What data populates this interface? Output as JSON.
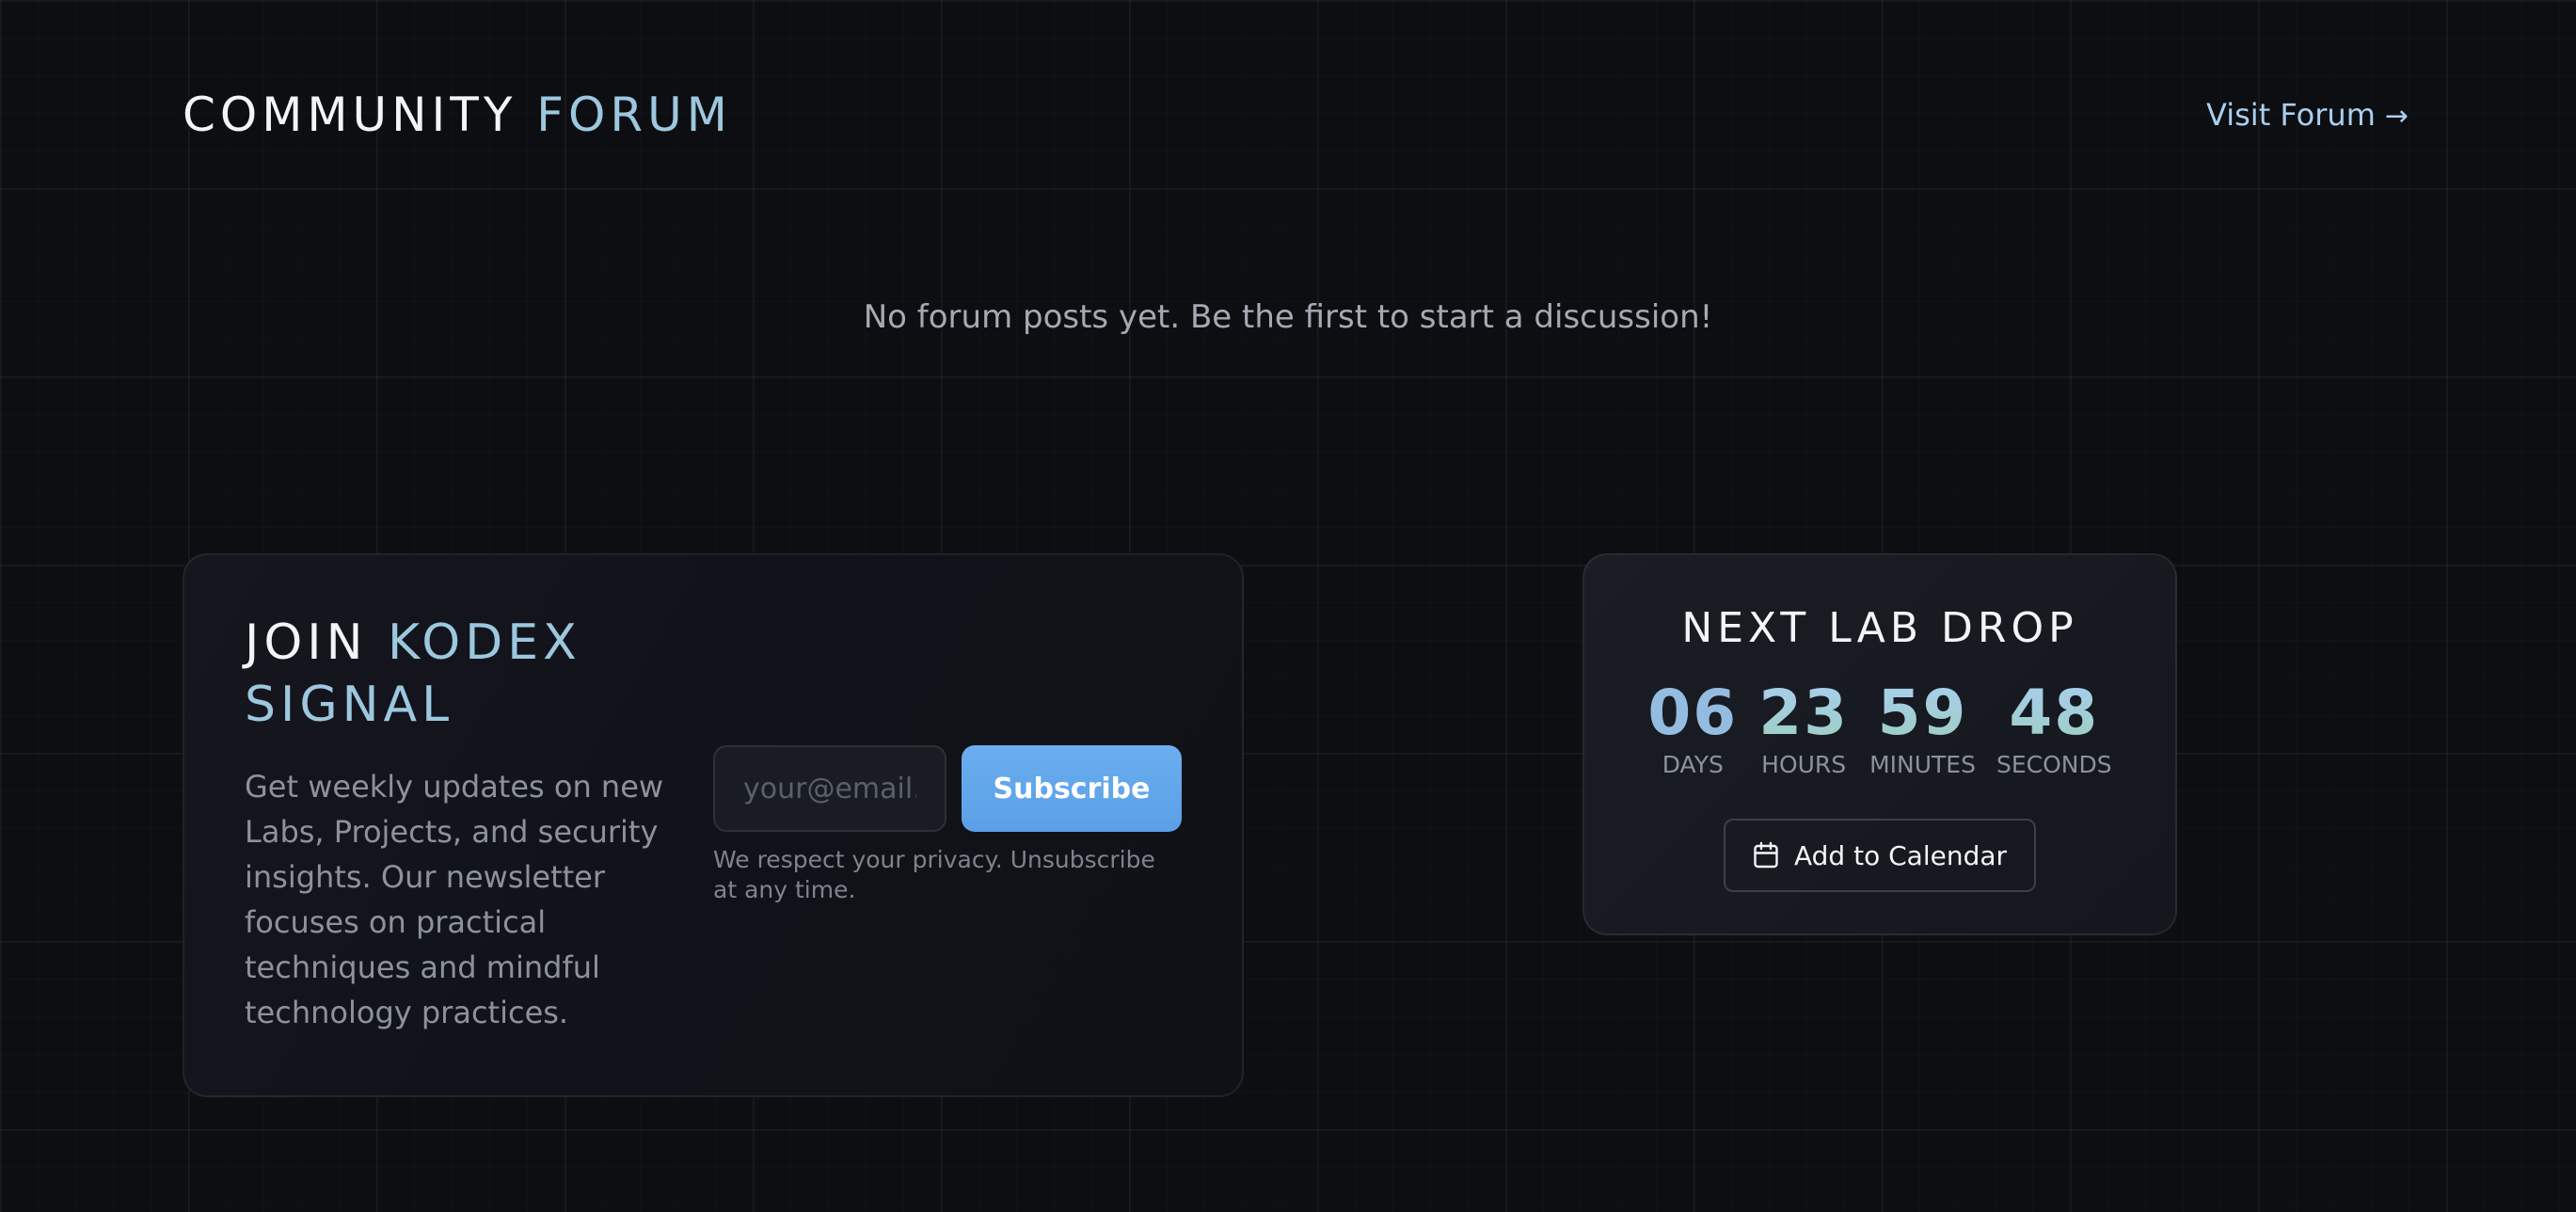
{
  "header": {
    "title_main": "COMMUNITY",
    "title_accent": "FORUM",
    "visit_link": "Visit Forum",
    "visit_arrow": "→"
  },
  "forum": {
    "empty_message": "No forum posts yet. Be the first to start a discussion!"
  },
  "newsletter": {
    "title_line1_main": "JOIN",
    "title_line1_accent": "KODEX",
    "title_line2": "SIGNAL",
    "description": "Get weekly updates on new Labs, Projects, and security insights. Our newsletter focuses on practical techniques and mindful technology practices.",
    "email_placeholder": "your@email.com",
    "email_value": "",
    "subscribe_label": "Subscribe",
    "privacy_note": "We respect your privacy. Unsubscribe at any time."
  },
  "lab_drop": {
    "title": "NEXT LAB DROP",
    "countdown": [
      {
        "value": "06",
        "label": "DAYS"
      },
      {
        "value": "23",
        "label": "HOURS"
      },
      {
        "value": "59",
        "label": "MINUTES"
      },
      {
        "value": "48",
        "label": "SECONDS"
      }
    ],
    "calendar_button": "Add to Calendar",
    "calendar_icon": "calendar-icon"
  },
  "colors": {
    "background": "#0d0e11",
    "accent_blue": "#a9cff0",
    "accent_teal": "#9cc7df",
    "button_blue": "#5b9fe6"
  }
}
